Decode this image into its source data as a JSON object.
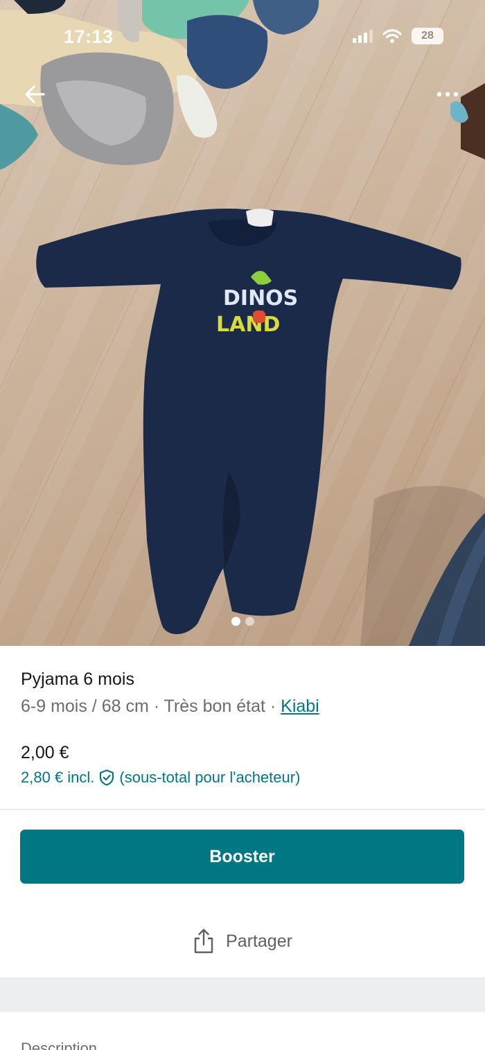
{
  "status_bar": {
    "time": "17:13",
    "battery": "28"
  },
  "photo": {
    "alt": "Pyjama 6 mois",
    "print_line1": "DINOS",
    "print_line2": "LAND",
    "page_count": 2,
    "active_index": 0
  },
  "nav": {
    "back_icon": "arrow-left-icon",
    "more_icon": "more-horizontal-icon"
  },
  "item": {
    "title": "Pyjama 6 mois",
    "size": "6-9 mois / 68 cm",
    "separator1": " · ",
    "condition": "Très bon état",
    "separator2": " · ",
    "brand": "Kiabi",
    "price": "2,00 €",
    "price_incl": "2,80 € incl.",
    "price_note": "(sous-total pour l'acheteur)"
  },
  "actions": {
    "booster_label": "Booster",
    "share_label": "Partager"
  },
  "description": {
    "label": "Description"
  },
  "colors": {
    "accent": "#007782",
    "text_primary": "#171717",
    "text_secondary": "#6c6c6c"
  }
}
